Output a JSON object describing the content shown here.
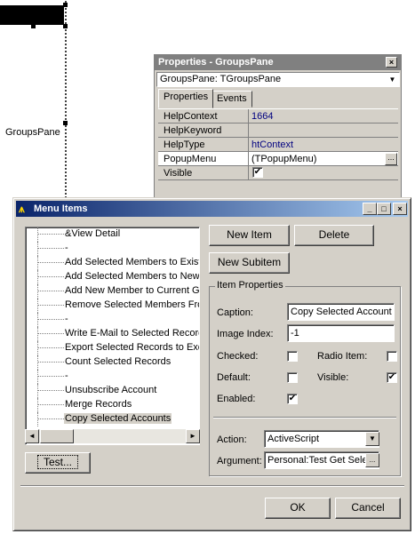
{
  "designer": {
    "component_label": "GroupsPane"
  },
  "properties_window": {
    "title": "Properties - GroupsPane",
    "close_glyph": "×",
    "object_selector": "GroupsPane: TGroupsPane",
    "tabs": [
      {
        "label": "Properties",
        "active": true
      },
      {
        "label": "Events",
        "active": false
      }
    ],
    "rows": [
      {
        "name": "HelpContext",
        "value": "1664"
      },
      {
        "name": "HelpKeyword",
        "value": ""
      },
      {
        "name": "HelpType",
        "value": "htContext"
      },
      {
        "name": "PopupMenu",
        "value": "(TPopupMenu)",
        "ellipsis": "..."
      },
      {
        "name": "Visible",
        "value": "✔"
      }
    ]
  },
  "menu_items_dialog": {
    "title": "Menu Items",
    "title_buttons": {
      "minimize": "_",
      "maximize": "□",
      "close": "×"
    },
    "items": [
      {
        "label": "&View Detail",
        "selected": false
      },
      {
        "label": "-",
        "selected": false
      },
      {
        "label": "Add Selected Members to Existin",
        "selected": false
      },
      {
        "label": "Add Selected Members to New G",
        "selected": false
      },
      {
        "label": "Add New Member to Current Gro",
        "selected": false
      },
      {
        "label": "Remove Selected Members From",
        "selected": false
      },
      {
        "label": "-",
        "selected": false
      },
      {
        "label": "Write E-Mail to Selected Records",
        "selected": false
      },
      {
        "label": "Export Selected Records to Exce",
        "selected": false
      },
      {
        "label": "Count Selected Records",
        "selected": false
      },
      {
        "label": "-",
        "selected": false
      },
      {
        "label": "Unsubscribe Account",
        "selected": false
      },
      {
        "label": "Merge Records",
        "selected": false
      },
      {
        "label": "Copy Selected Accounts",
        "selected": true
      }
    ],
    "buttons": {
      "new_item": "New Item",
      "delete": "Delete",
      "new_subitem": "New Subitem",
      "test": "Test...",
      "ok": "OK",
      "cancel": "Cancel"
    },
    "item_properties": {
      "group_label": "Item Properties",
      "caption_label": "Caption:",
      "caption_value": "Copy Selected Account",
      "image_index_label": "Image Index:",
      "image_index_value": "-1",
      "checked_label": "Checked:",
      "checked": false,
      "radio_item_label": "Radio Item:",
      "radio_item": false,
      "default_label": "Default:",
      "default": false,
      "visible_label": "Visible:",
      "visible": true,
      "enabled_label": "Enabled:",
      "enabled": true,
      "check_glyph": "✔",
      "action_label": "Action:",
      "action_value": "ActiveScript",
      "argument_label": "Argument:",
      "argument_value": "Personal:Test Get Sele",
      "argument_ellipsis": "..."
    },
    "scroll_glyphs": {
      "left": "◄",
      "right": "►",
      "down": "▼"
    }
  },
  "colors": {
    "face": "#d4d0c8",
    "title_active_start": "#0a246a",
    "title_active_end": "#a6caf0",
    "title_inactive": "#808080",
    "value_text": "#000080"
  }
}
